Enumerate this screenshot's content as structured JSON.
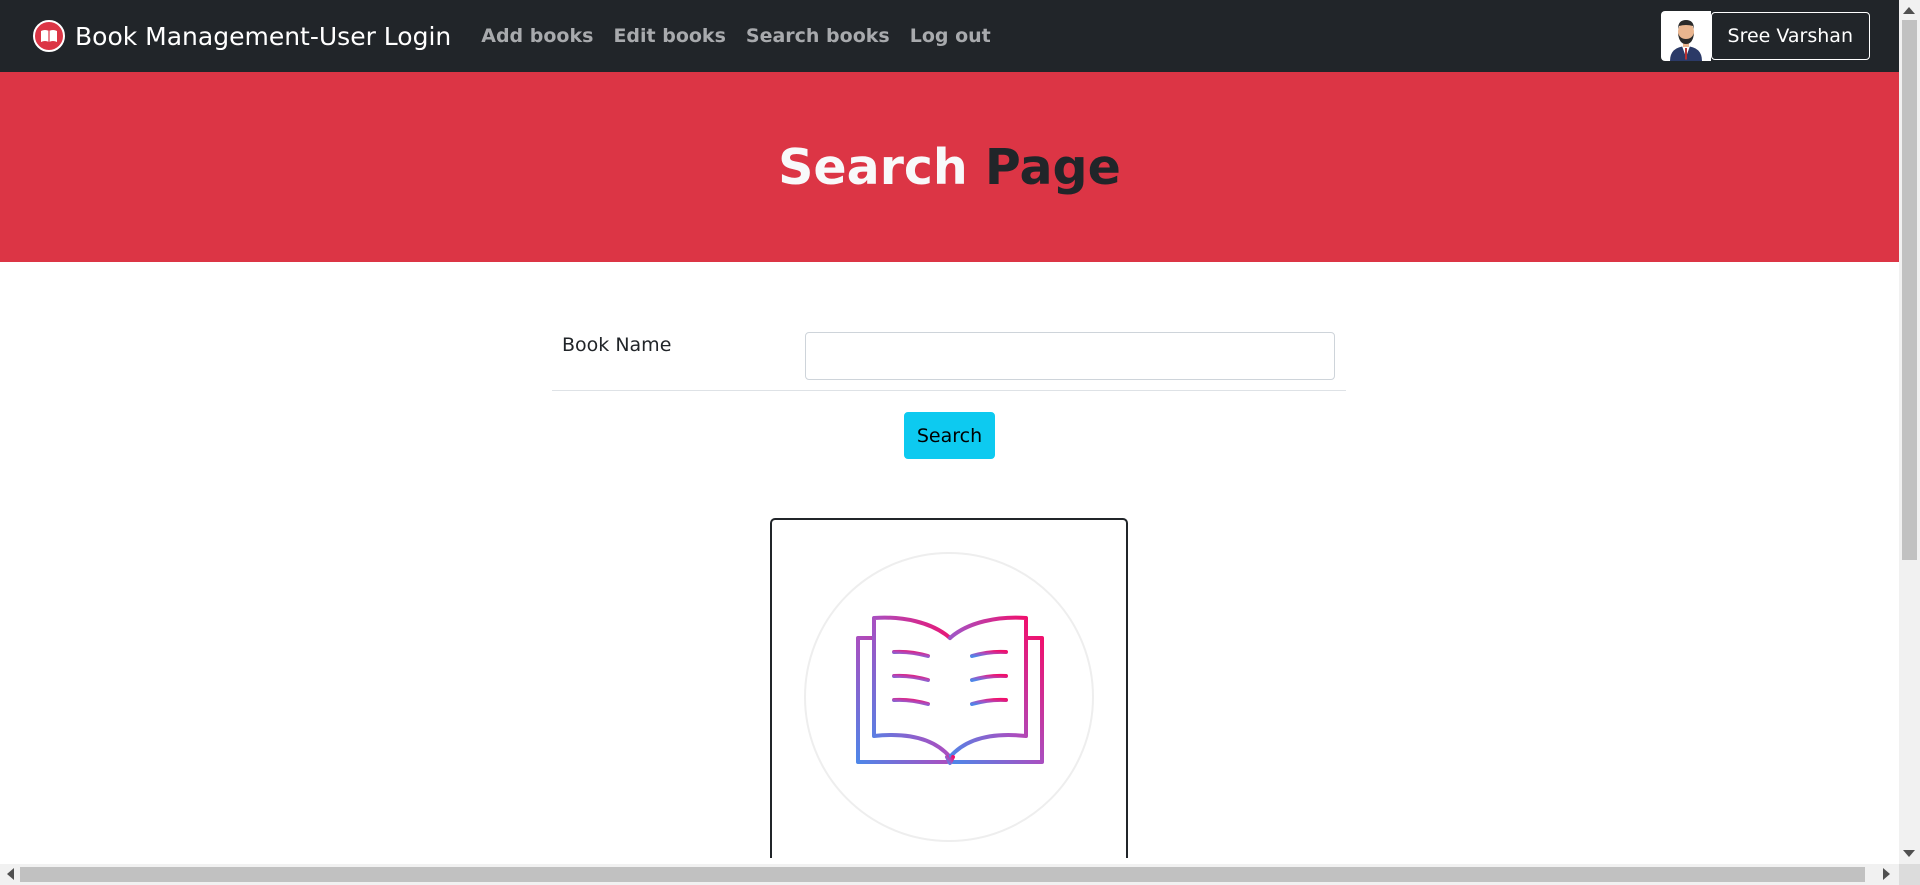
{
  "navbar": {
    "brand_title": "Book Management-User Login",
    "brand_icon": "book-logo-icon",
    "links": [
      "Add books",
      "Edit books",
      "Search books",
      "Log out"
    ],
    "user_name": "Sree Varshan",
    "avatar_icon": "user-avatar-icon"
  },
  "hero": {
    "title_part1": "Search",
    "title_part2": "Page"
  },
  "form": {
    "label": "Book Name",
    "input_value": "",
    "search_label": "Search"
  },
  "result": {
    "icon": "open-book-icon"
  },
  "colors": {
    "navbar_bg": "#212529",
    "hero_bg": "#dc3545",
    "button_info": "#0dcaf0",
    "icon_gradient_start": "#4f86e8",
    "icon_gradient_end": "#f0106d"
  }
}
